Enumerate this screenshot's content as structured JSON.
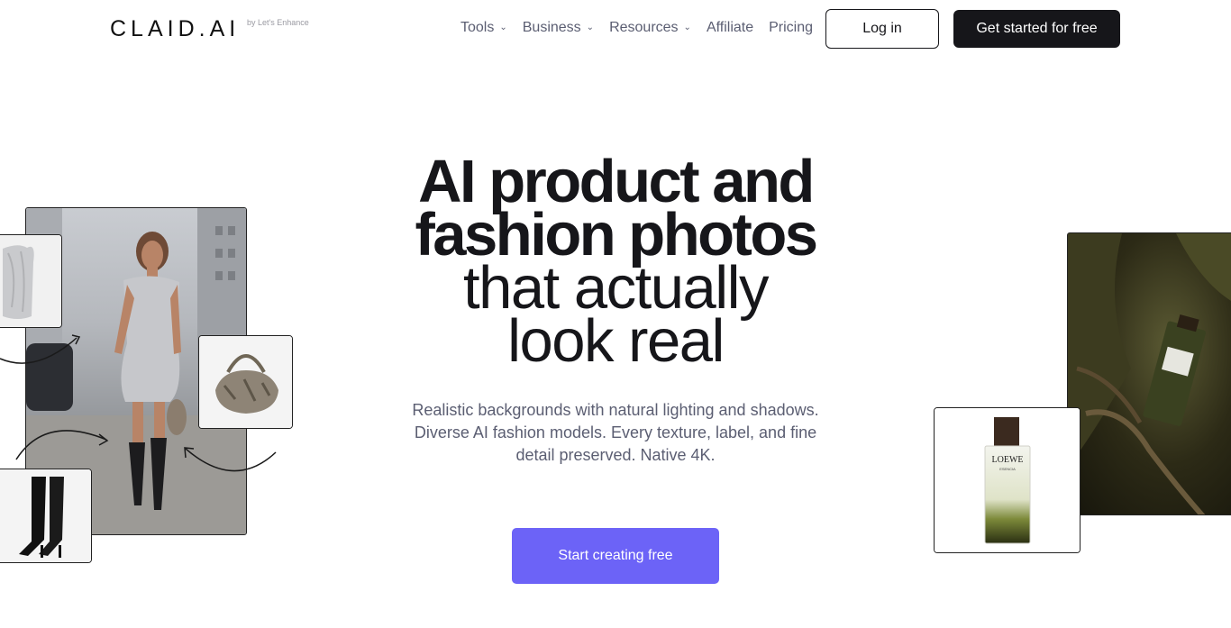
{
  "header": {
    "logo": "CLAID.AI",
    "logo_sub": "by Let's Enhance",
    "nav": [
      {
        "label": "Tools",
        "has_dropdown": true
      },
      {
        "label": "Business",
        "has_dropdown": true
      },
      {
        "label": "Resources",
        "has_dropdown": true
      },
      {
        "label": "Affiliate",
        "has_dropdown": false
      },
      {
        "label": "Pricing",
        "has_dropdown": false
      }
    ],
    "login_label": "Log in",
    "cta_label": "Get started for free"
  },
  "hero": {
    "title_line1": "AI product and",
    "title_line2": "fashion photos",
    "title_line3": "that actually",
    "title_line4": "look real",
    "subtitle": "Realistic backgrounds with natural lighting and shadows. Diverse AI fashion models. Every texture, label, and fine detail preserved. Native 4K.",
    "cta_label": "Start creating free"
  },
  "collage": {
    "perfume_label": "LOEWE",
    "perfume_sub": "ESENCIA"
  },
  "colors": {
    "accent": "#6c63f7",
    "dark": "#16161a",
    "nav_text": "#5b5e72"
  }
}
